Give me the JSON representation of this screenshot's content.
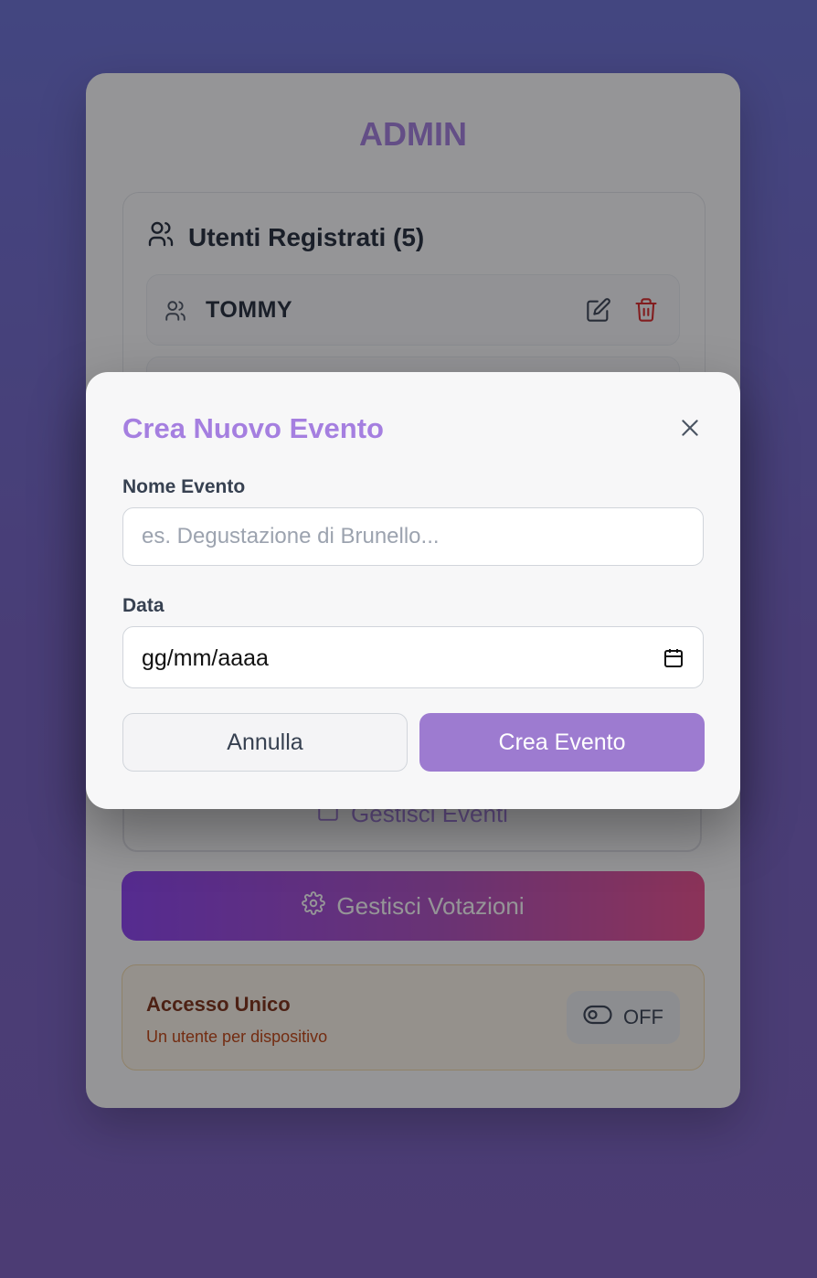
{
  "admin": {
    "title": "ADMIN",
    "users": {
      "heading": "Utenti Registrati (5)",
      "items": [
        {
          "name": "TOMMY"
        }
      ]
    },
    "manage_events_label": "Gestisci Eventi",
    "manage_votes_label": "Gestisci Votazioni",
    "single_access": {
      "title": "Accesso Unico",
      "subtitle": "Un utente per dispositivo",
      "toggle_label": "OFF"
    }
  },
  "modal": {
    "title": "Crea Nuovo Evento",
    "name_label": "Nome Evento",
    "name_placeholder": "es. Degustazione di Brunello...",
    "name_value": "",
    "date_label": "Data",
    "date_placeholder": "gg/mm/aaaa",
    "cancel_label": "Annulla",
    "create_label": "Crea Evento"
  },
  "colors": {
    "accent": "#a57fe0",
    "create_button": "#9d7bd0",
    "delete_icon": "#dc2626"
  }
}
